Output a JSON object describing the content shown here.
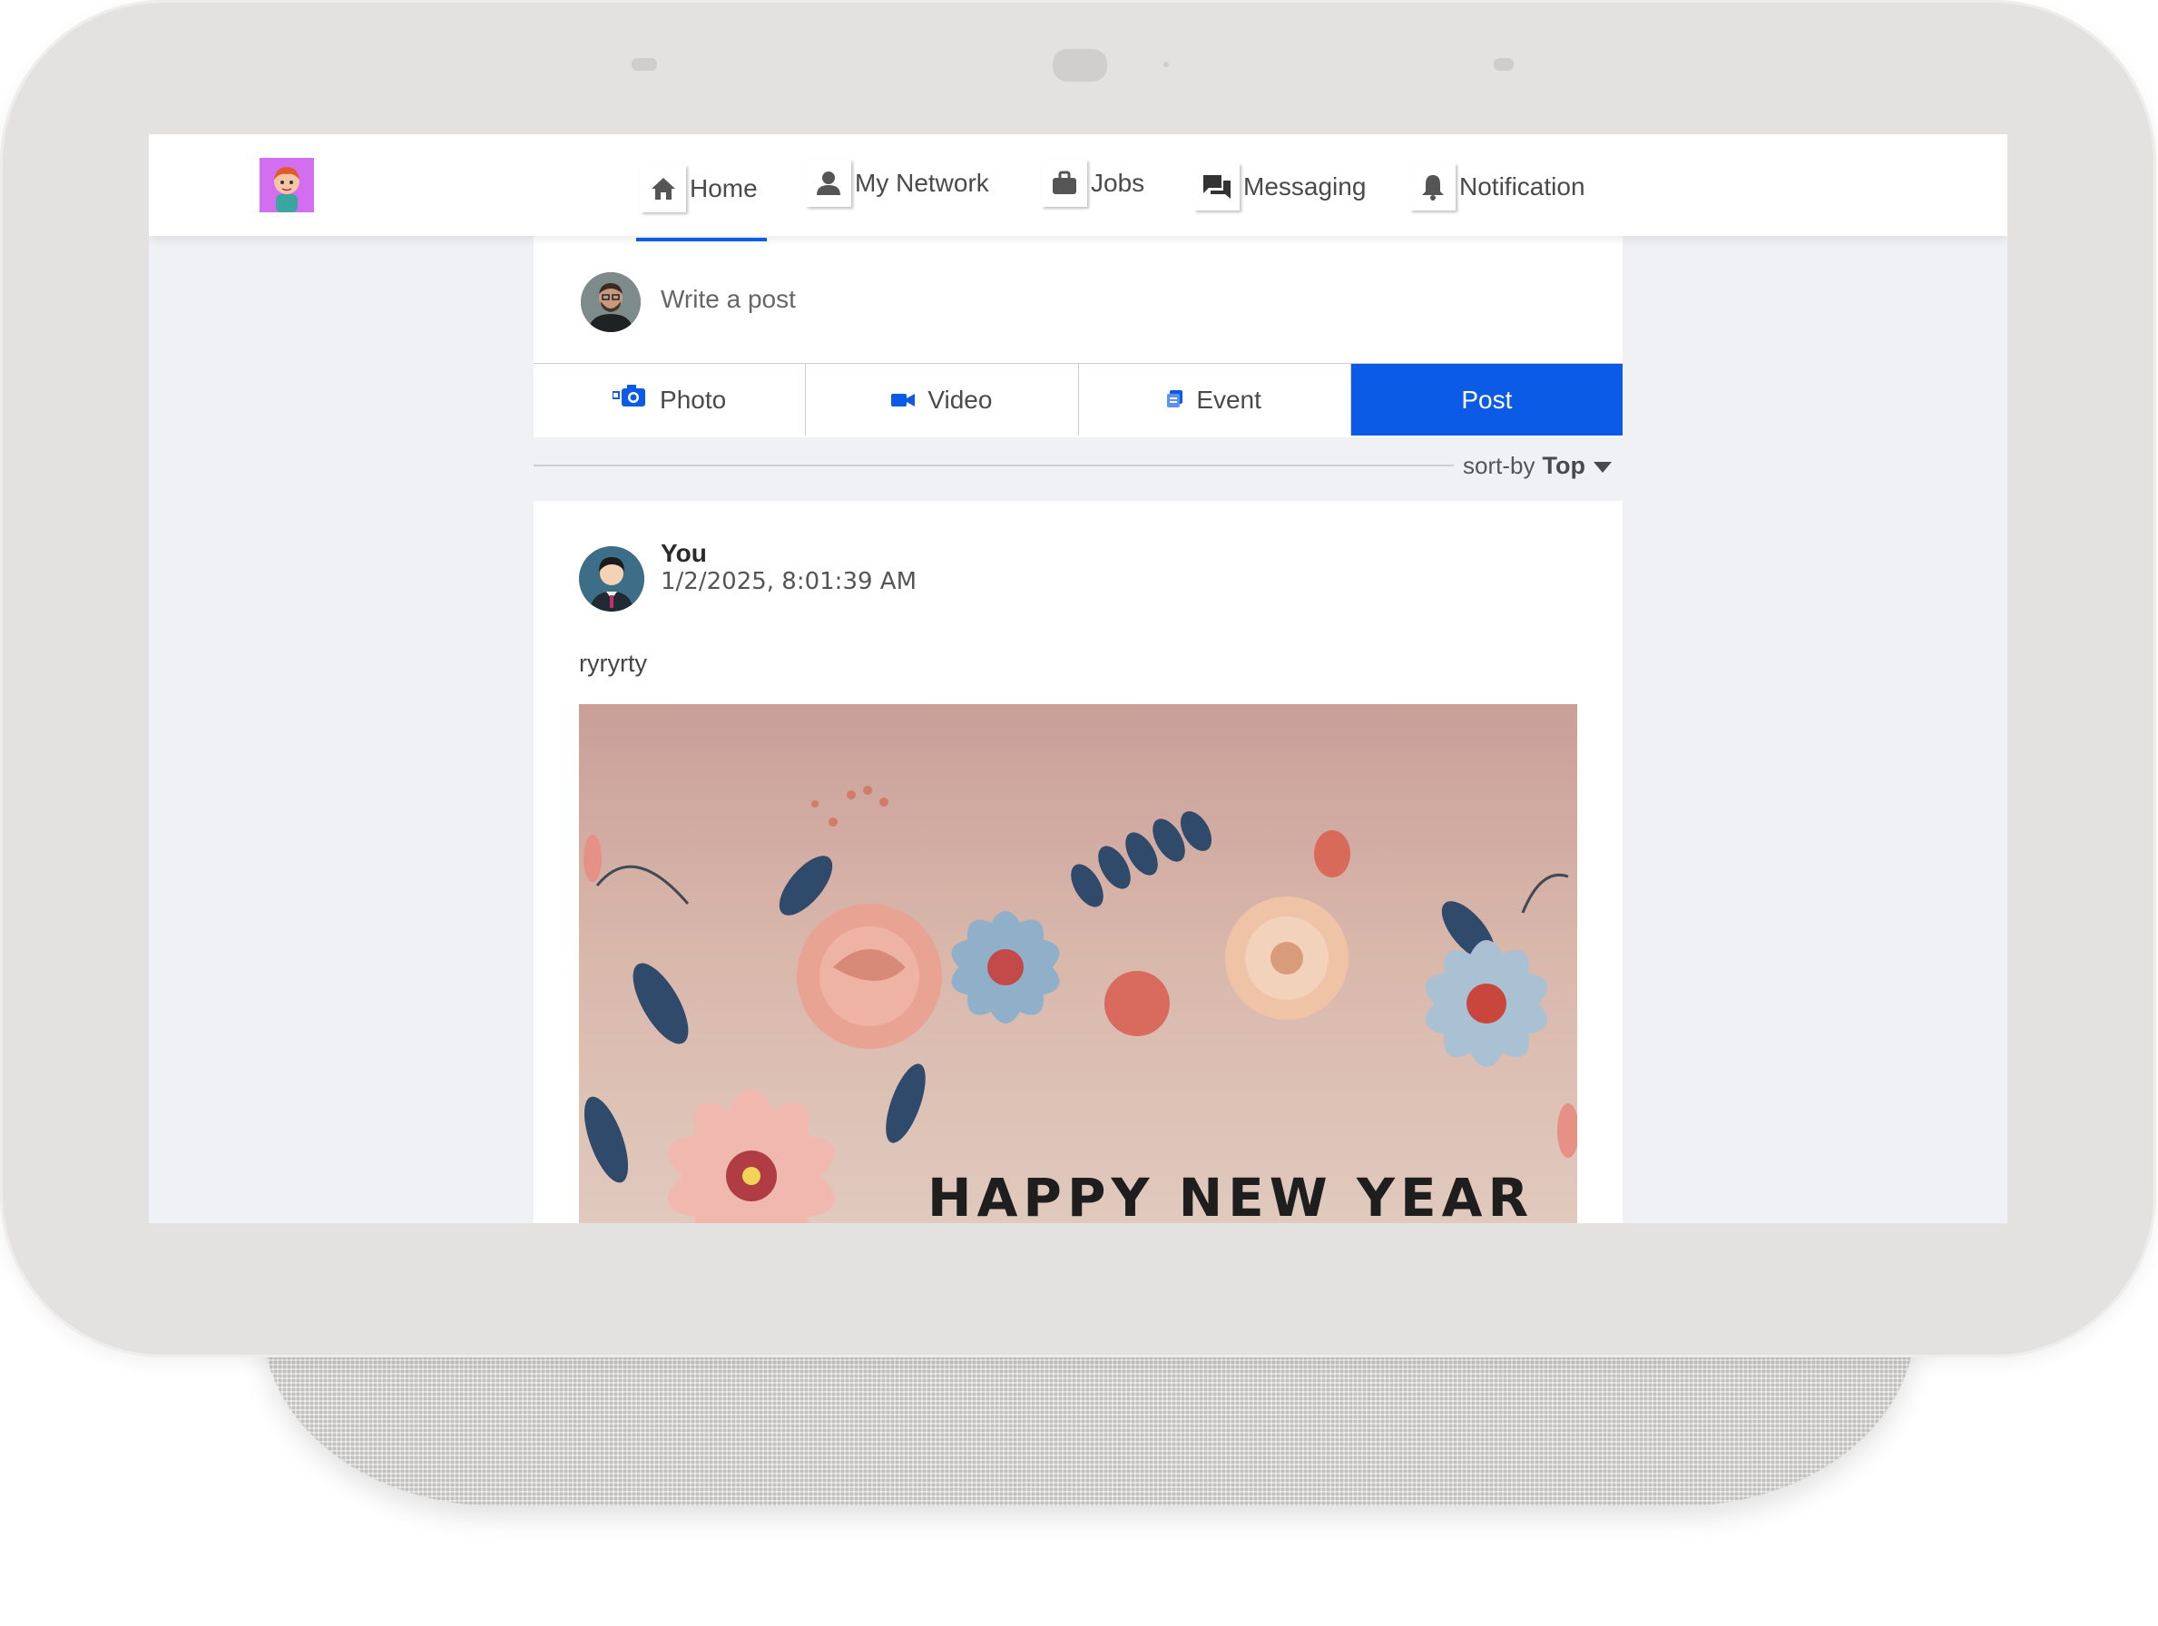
{
  "nav": {
    "items": [
      {
        "label": "Home",
        "icon": "home-icon"
      },
      {
        "label": "My Network",
        "icon": "person-icon"
      },
      {
        "label": "Jobs",
        "icon": "briefcase-icon"
      },
      {
        "label": "Messaging",
        "icon": "chat-icon"
      },
      {
        "label": "Notification",
        "icon": "bell-icon"
      }
    ],
    "active": "Home",
    "accent_color": "#0b5be6"
  },
  "composer": {
    "placeholder": "Write a post",
    "actions": {
      "photo": "Photo",
      "video": "Video",
      "event": "Event",
      "post": "Post"
    }
  },
  "sort": {
    "prefix": "sort-by",
    "value": "Top"
  },
  "post": {
    "author": "You",
    "timestamp": "1/2/2025, 8:01:39 AM",
    "text": "ryryrty",
    "image_caption": "HAPPY NEW YEAR"
  }
}
